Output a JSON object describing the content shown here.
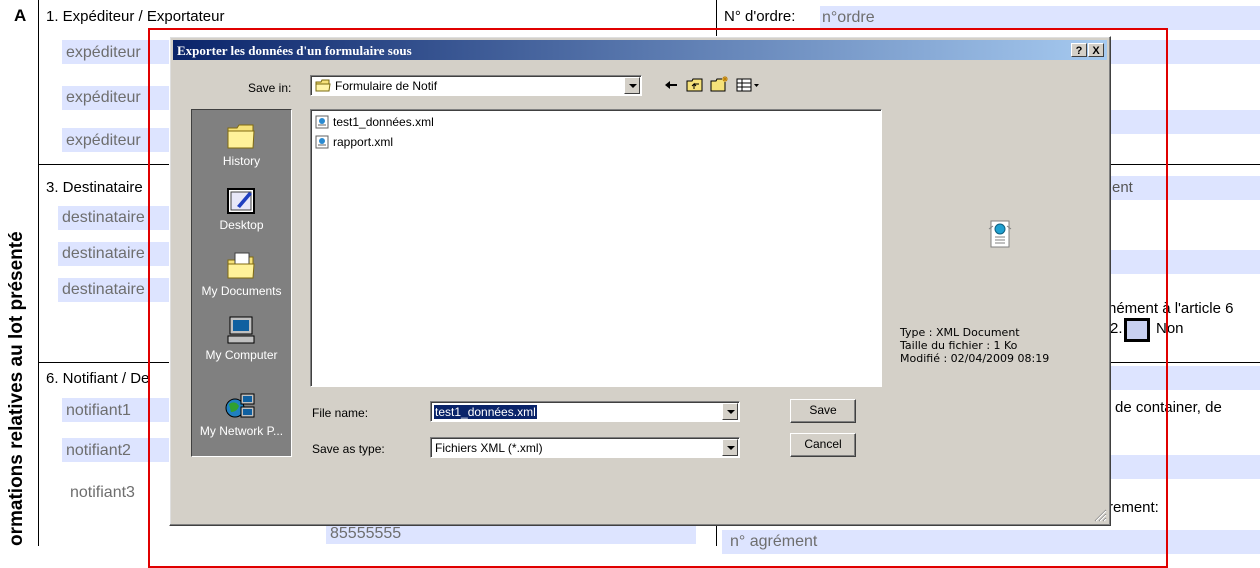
{
  "background_form": {
    "section_letter": "A",
    "side_label": "ormations relatives au lot présenté",
    "sec1_label": "1. Expéditeur / Exportateur",
    "order_label": "N° d'ordre:",
    "order_value": "n°ordre",
    "exp_fields": [
      "expéditeur",
      "expéditeur",
      "expéditeur"
    ],
    "sec3_label": "3. Destinataire",
    "dest_fields": [
      "destinataire",
      "destinataire",
      "destinataire"
    ],
    "ent_text": "ent",
    "article_text": "hément à l'article 6",
    "non_prefix": "2.",
    "non_label": "Non",
    "sec6_label": "6. Notifiant / De",
    "notif_fields": [
      "notifiant1",
      "notifiant2",
      "notifiant3"
    ],
    "container_text": "' de container, de",
    "phone_value": "85555555",
    "agrement_label": "rement:",
    "agrement_value": "n° agrément"
  },
  "dialog": {
    "title": "Exporter les données d'un formulaire sous",
    "help_btn": "?",
    "close_btn": "X",
    "save_in_label": "Save in:",
    "save_in_value": "Formulaire de Notif",
    "places": [
      {
        "label": "History",
        "icon": "history-icon"
      },
      {
        "label": "Desktop",
        "icon": "desktop-icon"
      },
      {
        "label": "My Documents",
        "icon": "my-documents-icon"
      },
      {
        "label": "My Computer",
        "icon": "my-computer-icon"
      },
      {
        "label": "My Network P...",
        "icon": "network-places-icon"
      }
    ],
    "files": [
      "test1_données.xml",
      "rapport.xml"
    ],
    "info_type": "Type : XML Document",
    "info_size": "Taille du fichier : 1 Ko",
    "info_modified": "Modifié : 02/04/2009 08:19",
    "file_name_label": "File name:",
    "file_name_value": "test1_données.xml",
    "save_type_label": "Save as type:",
    "save_type_value": "Fichiers XML (*.xml)",
    "save_btn": "Save",
    "cancel_btn": "Cancel",
    "colors": {
      "titlebar_start": "#0a246a",
      "titlebar_end": "#a6caf0",
      "places_bg": "#808080",
      "face": "#d4d0c8",
      "field_highlight": "#dde4ff",
      "annotation_red": "#e00000"
    }
  }
}
